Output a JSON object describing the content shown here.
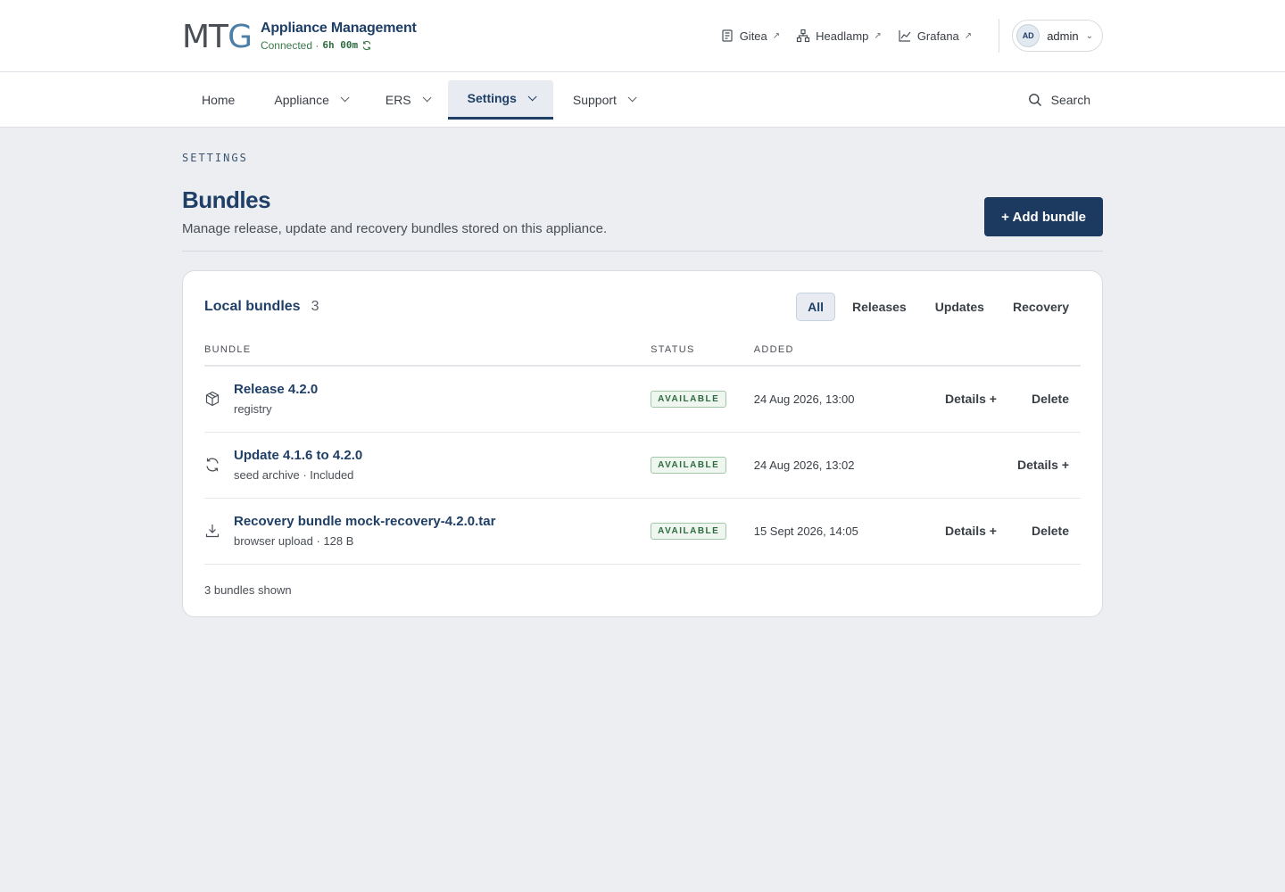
{
  "brand": {
    "logo_a": "MT",
    "logo_b": "G",
    "title": "Appliance Management",
    "status_prefix": "Connected ·",
    "uptime": "6h 00m"
  },
  "external_links": [
    {
      "label": "Gitea",
      "icon": "document-icon"
    },
    {
      "label": "Headlamp",
      "icon": "network-icon"
    },
    {
      "label": "Grafana",
      "icon": "chart-icon"
    }
  ],
  "user": {
    "initials": "AD",
    "name": "admin"
  },
  "nav": {
    "items": [
      {
        "label": "Home"
      },
      {
        "label": "Appliance"
      },
      {
        "label": "ERS"
      },
      {
        "label": "Settings"
      },
      {
        "label": "Support"
      }
    ],
    "active": "Settings",
    "search_label": "Search"
  },
  "page": {
    "eyebrow": "SETTINGS",
    "title": "Bundles",
    "subtitle": "Manage release, update and recovery bundles stored on this appliance.",
    "add_button": "+ Add bundle"
  },
  "card": {
    "title": "Local bundles",
    "count": "3",
    "filters": [
      "All",
      "Releases",
      "Updates",
      "Recovery"
    ],
    "active_filter": "All",
    "columns": {
      "bundle": "BUNDLE",
      "status": "STATUS",
      "added": "ADDED"
    },
    "rows": [
      {
        "icon": "package-icon",
        "name": "Release 4.2.0",
        "meta": "registry",
        "status": "AVAILABLE",
        "added": "24 Aug 2026, 13:00",
        "details": "Details +",
        "delete": "Delete"
      },
      {
        "icon": "sync-icon",
        "name": "Update 4.1.6 to 4.2.0",
        "meta": "seed archive · Included",
        "status": "AVAILABLE",
        "added": "24 Aug 2026, 13:02",
        "details": "Details +",
        "delete": ""
      },
      {
        "icon": "download-icon",
        "name": "Recovery bundle mock-recovery-4.2.0.tar",
        "meta": "browser upload · 128 B",
        "status": "AVAILABLE",
        "added": "15 Sept 2026, 14:05",
        "details": "Details +",
        "delete": "Delete"
      }
    ],
    "footer": "3 bundles shown"
  },
  "colors": {
    "brand_navy": "#1f3f66",
    "button_navy": "#1c3a5f",
    "available_green": "#2f6b40",
    "page_bg": "#eceef1"
  }
}
